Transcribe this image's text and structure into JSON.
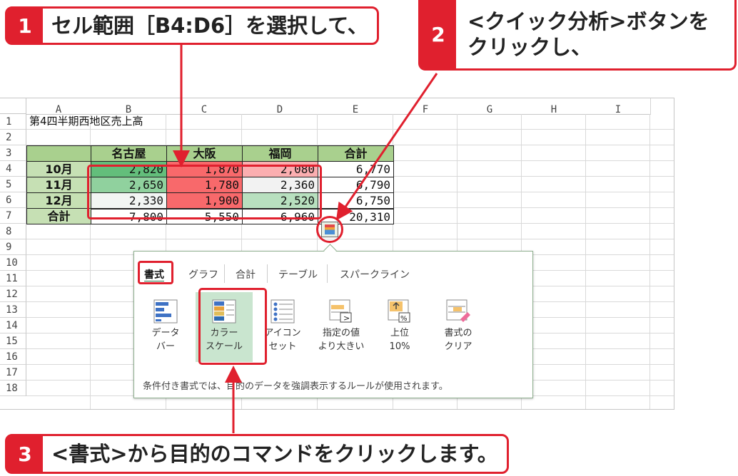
{
  "callouts": {
    "c1": {
      "num": "1",
      "text": "セル範囲［B4:D6］を選択して、"
    },
    "c2": {
      "num": "2",
      "text_line1": "<クイック分析>ボタンを",
      "text_line2": "クリックし、"
    },
    "c3": {
      "num": "3",
      "text": "<書式>から目的のコマンドをクリックします。"
    }
  },
  "accent_color": "#e0202e",
  "sheet": {
    "columns": [
      "A",
      "B",
      "C",
      "D",
      "E",
      "F",
      "G",
      "H",
      "I"
    ],
    "rows": [
      "1",
      "2",
      "3",
      "4",
      "5",
      "6",
      "7",
      "8",
      "9",
      "10",
      "11",
      "12",
      "13",
      "14",
      "15",
      "16",
      "17",
      "18"
    ],
    "title": "第4四半期西地区売上高",
    "headers": [
      "名古屋",
      "大阪",
      "福岡",
      "合計"
    ],
    "row_labels": [
      "10月",
      "11月",
      "12月",
      "合計"
    ],
    "values": [
      [
        "2,820",
        "1,870",
        "2,080",
        "6,770"
      ],
      [
        "2,650",
        "1,780",
        "2,360",
        "6,790"
      ],
      [
        "2,330",
        "1,900",
        "2,520",
        "6,750"
      ],
      [
        "7,800",
        "5,550",
        "6,960",
        "20,310"
      ]
    ],
    "color_scale": [
      [
        "#63be7b",
        "#f8696b",
        "#fbaeb0"
      ],
      [
        "#90d19e",
        "#f8696b",
        "#f2f2f2"
      ],
      [
        "#f2f5f3",
        "#f8696b",
        "#b8e0bf"
      ]
    ]
  },
  "quick_analysis": {
    "tabs": [
      "書式",
      "グラフ",
      "合計",
      "テーブル",
      "スパークライン"
    ],
    "active_tab": "書式",
    "options": [
      {
        "line1": "データ",
        "line2": "バー",
        "icon": "data-bar-icon"
      },
      {
        "line1": "カラー",
        "line2": "スケール",
        "icon": "color-scale-icon"
      },
      {
        "line1": "アイコン",
        "line2": "セット",
        "icon": "icon-set-icon"
      },
      {
        "line1": "指定の値",
        "line2": "より大きい",
        "icon": "greater-than-icon"
      },
      {
        "line1": "上位",
        "line2": "10%",
        "icon": "top-10-percent-icon"
      },
      {
        "line1": "書式の",
        "line2": "クリア",
        "icon": "clear-format-icon"
      }
    ],
    "selected_option": "カラースケール",
    "footer_text": "条件付き書式では、目的のデータを強調表示するルールが使用されます。"
  }
}
